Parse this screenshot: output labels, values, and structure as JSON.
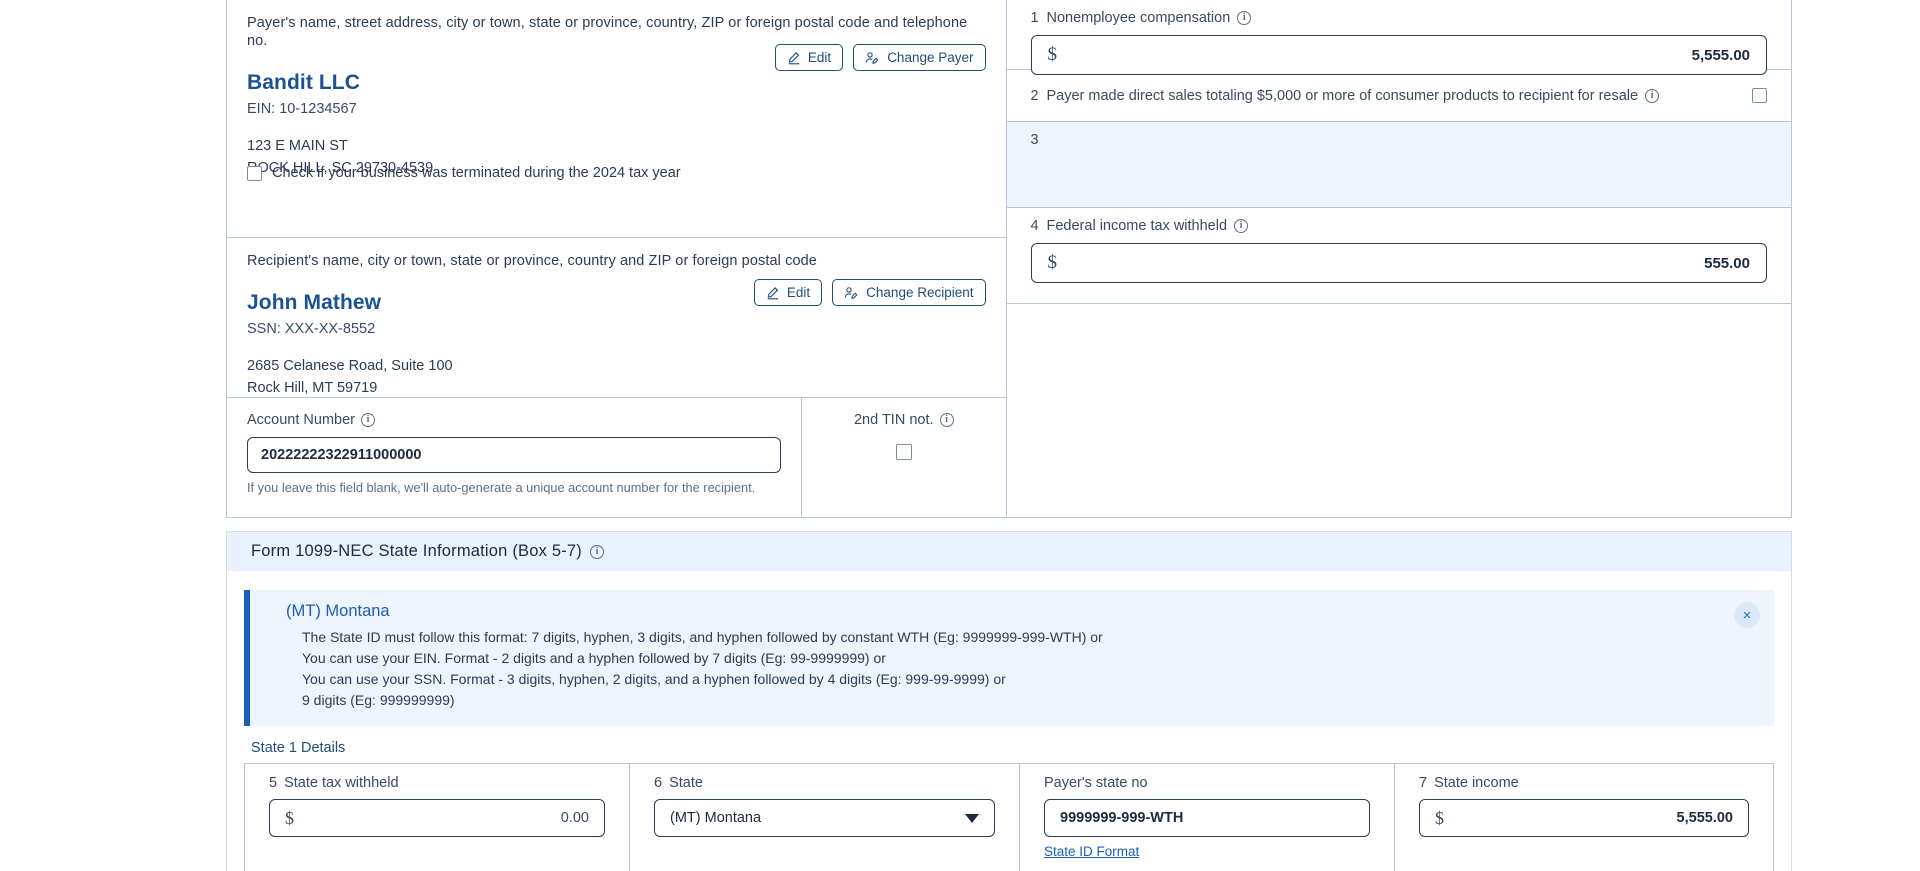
{
  "payer": {
    "caption": "Payer's name, street address, city or town, state or province, country, ZIP or foreign postal code and telephone no.",
    "name": "Bandit LLC",
    "tin_label": "EIN: 10-1234567",
    "address_line1": "123 E MAIN ST",
    "address_line2": "ROCK HILL, SC 29730-4539",
    "edit_label": "Edit",
    "change_label": "Change Payer",
    "terminated_label": "Check if your business was terminated during the 2024 tax year"
  },
  "recipient": {
    "caption": "Recipient's name, city or town, state or province, country and ZIP or foreign postal code",
    "name": "John Mathew",
    "tin_label": "SSN: XXX-XX-8552",
    "address_line1": "2685 Celanese Road, Suite 100",
    "address_line2": "Rock Hill, MT 59719",
    "edit_label": "Edit",
    "change_label": "Change Recipient"
  },
  "account": {
    "label": "Account Number",
    "value": "20222222322911000000",
    "hint": "If you leave this field blank, we'll auto-generate a unique account number for the recipient.",
    "second_tin_label": "2nd TIN not."
  },
  "boxes": {
    "box1": {
      "num": "1",
      "label": "Nonemployee compensation",
      "currency": "$",
      "value": "5,555.00"
    },
    "box2": {
      "num": "2",
      "label": "Payer made direct sales totaling $5,000 or more of consumer products to recipient for resale"
    },
    "box3": {
      "num": "3",
      "label": ""
    },
    "box4": {
      "num": "4",
      "label": "Federal income tax withheld",
      "currency": "$",
      "value": "555.00"
    }
  },
  "state_section": {
    "title": "Form 1099-NEC  State Information  (Box 5-7)",
    "callout": {
      "title": "(MT) Montana",
      "line1": "The State ID must follow this format: 7 digits, hyphen, 3 digits, and hyphen followed by constant WTH (Eg: 9999999-999-WTH) or",
      "line2": "You can use your EIN. Format - 2 digits and a hyphen followed by 7 digits (Eg: 99-9999999) or",
      "line3": "You can use your SSN. Format - 3 digits, hyphen, 2 digits, and a hyphen followed by 4 digits (Eg: 999-99-9999) or",
      "line4": "9 digits (Eg: 999999999)",
      "close_label": "×"
    },
    "details_label": "State 1 Details",
    "box5": {
      "num": "5",
      "label": "State tax withheld",
      "currency": "$",
      "value": "0.00"
    },
    "box6": {
      "num": "6",
      "label": "State",
      "selected": "(MT) Montana"
    },
    "payer_state_no": {
      "label": "Payer's state no",
      "value": "9999999-999-WTH",
      "link": "State ID Format"
    },
    "box7": {
      "num": "7",
      "label": "State income",
      "currency": "$",
      "value": "5,555.00"
    }
  },
  "colors": {
    "accent_blue": "#1a5fb4",
    "header_bg": "#e8f1fd",
    "box3_bg": "#eef4fc",
    "border": "#b9c6d8",
    "text": "#2b3c53"
  }
}
